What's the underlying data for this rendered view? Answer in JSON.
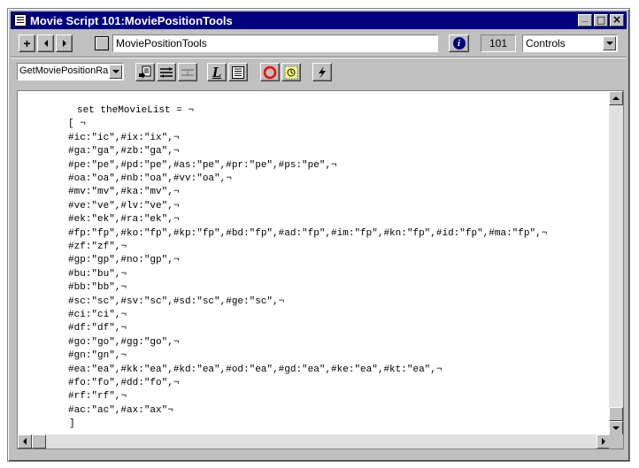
{
  "window": {
    "title": "Movie Script 101:MoviePositionTools",
    "controls": {
      "minimize": "_",
      "maximize": "□",
      "close": "×"
    }
  },
  "toolbar": {
    "add_label": "+",
    "prev_label": "◄",
    "next_label": "►",
    "script_name": "MoviePositionTools",
    "info_label": "i",
    "cast_number": "101",
    "category_dropdown": "Controls"
  },
  "toolbar2": {
    "handler_dropdown": "GetMoviePositionRa",
    "lingo_label": "L",
    "icons": [
      "go-to-handler-icon",
      "comment-icon",
      "uncomment-icon",
      "alphabetical-lingo-icon",
      "categorized-lingo-icon",
      "toggle-breakpoint-icon",
      "watch-expression-icon",
      "recompile-icon"
    ]
  },
  "code_lines": [
    "set theMovieList = ¬",
    "[ ¬",
    "#ic:\"ic\",#ix:\"ix\",¬",
    "#ga:\"ga\",#zb:\"ga\",¬",
    "#pe:\"pe\",#pd:\"pe\",#as:\"pe\",#pr:\"pe\",#ps:\"pe\",¬",
    "#oa:\"oa\",#nb:\"oa\",#vv:\"oa\",¬",
    "#mv:\"mv\",#ka:\"mv\",¬",
    "#ve:\"ve\",#lv:\"ve\",¬",
    "#ek:\"ek\",#ra:\"ek\",¬",
    "#fp:\"fp\",#ko:\"fp\",#kp:\"fp\",#bd:\"fp\",#ad:\"fp\",#im:\"fp\",#kn:\"fp\",#id:\"fp\",#ma:\"fp\",¬",
    "#zf:\"zf\",¬",
    "#gp:\"gp\",#no:\"gp\",¬",
    "#bu:\"bu\",¬",
    "#bb:\"bb\",¬",
    "#sc:\"sc\",#sv:\"sc\",#sd:\"sc\",#ge:\"sc\",¬",
    "#ci:\"ci\",¬",
    "#df:\"df\",¬",
    "#go:\"go\",#gg:\"go\",¬",
    "#gn:\"gn\",¬",
    "#ea:\"ea\",#kk:\"ea\",#kd:\"ea\",#od:\"ea\",#gd:\"ea\",#ke:\"ea\",#kt:\"ea\",¬",
    "#fo:\"fo\",#dd:\"fo\",¬",
    "#rf:\"rf\",¬",
    "#ac:\"ac\",#ax:\"ax\"¬",
    "]"
  ],
  "code_first_line": "set theMovieList = ¬",
  "colors": {
    "titlebar": "#000080",
    "chrome": "#c0c0c0",
    "breakpoint": "#ff0000",
    "info_button": "#000080"
  }
}
